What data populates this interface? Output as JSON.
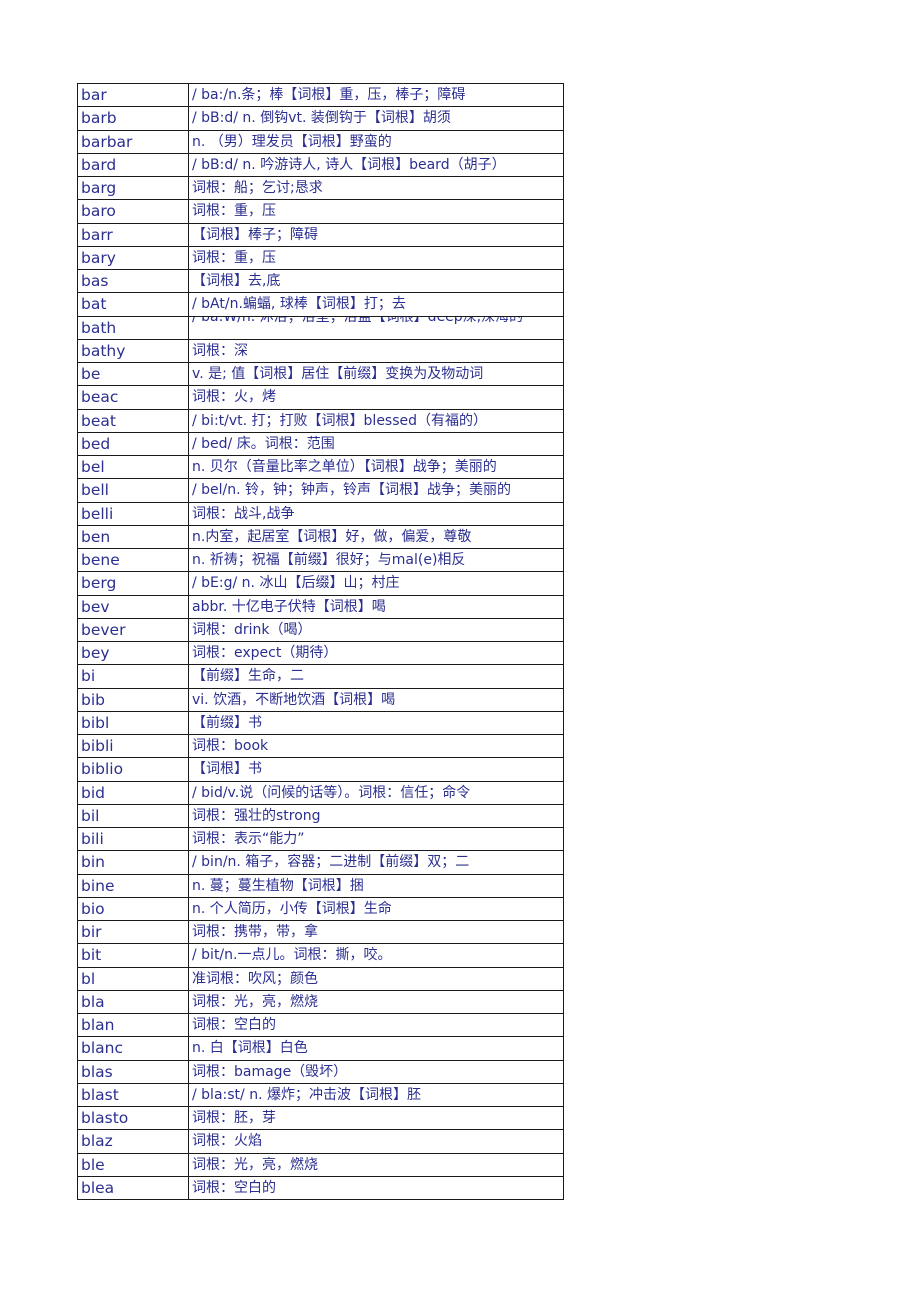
{
  "document": {
    "table": {
      "columns": [
        "term",
        "definition"
      ],
      "rows": [
        {
          "term": "bar",
          "definition": "/ ba:/n.条；棒【词根】重，压，棒子；障碍"
        },
        {
          "term": "barb",
          "definition": "/ bB:d/ n. 倒钩vt. 装倒钩于【词根】胡须"
        },
        {
          "term": "barbar",
          "definition": "n. （男）理发员【词根】野蛮的"
        },
        {
          "term": "bard",
          "definition": "/ bB:d/ n. 吟游诗人, 诗人【词根】beard（胡子）"
        },
        {
          "term": "barg",
          "definition": "词根：船；乞讨;恳求"
        },
        {
          "term": "baro",
          "definition": "词根：重，压"
        },
        {
          "term": "barr",
          "definition": "【词根】棒子；障碍"
        },
        {
          "term": "bary",
          "definition": "词根：重，压"
        },
        {
          "term": "bas",
          "definition": "【词根】去,底"
        },
        {
          "term": "bat",
          "definition": "/ bAt/n.蝙蝠, 球棒【词根】打；去"
        },
        {
          "term": "bath",
          "definition": "/ ba:W/n. 沐浴；浴室；浴盆【词根】deep深,深海的"
        },
        {
          "term": "bathy",
          "definition": "词根：深"
        },
        {
          "term": "be",
          "definition": "v. 是; 值【词根】居住【前缀】变换为及物动词"
        },
        {
          "term": "beac",
          "definition": "词根：火，烤"
        },
        {
          "term": "beat",
          "definition": "/ bi:t/vt. 打；打败【词根】blessed（有福的）"
        },
        {
          "term": "bed",
          "definition": "/ bed/  床。词根：范围"
        },
        {
          "term": "bel",
          "definition": "n. 贝尔（音量比率之单位）【词根】战争；美丽的"
        },
        {
          "term": "bell",
          "definition": "/ bel/n. 铃，钟；钟声，铃声【词根】战争；美丽的"
        },
        {
          "term": "belli",
          "definition": "词根：战斗,战争"
        },
        {
          "term": "ben",
          "definition": "n.内室，起居室【词根】好，做，偏爱，尊敬"
        },
        {
          "term": "bene",
          "definition": "n. 祈祷；祝福【前缀】很好；与mal(e)相反"
        },
        {
          "term": "berg",
          "definition": "/ bE:g/ n. 冰山【后缀】山；村庄"
        },
        {
          "term": "bev",
          "definition": "abbr. 十亿电子伏特【词根】喝"
        },
        {
          "term": "bever",
          "definition": "词根：drink（喝）"
        },
        {
          "term": "bey",
          "definition": "词根：expect（期待）"
        },
        {
          "term": "bi",
          "definition": "【前缀】生命，二"
        },
        {
          "term": "bib",
          "definition": "vi. 饮酒，不断地饮酒【词根】喝"
        },
        {
          "term": "bibl",
          "definition": "【前缀】书"
        },
        {
          "term": "bibli",
          "definition": "词根：book"
        },
        {
          "term": "biblio",
          "definition": "【词根】书"
        },
        {
          "term": "bid",
          "definition": "/ bid/v.说（问候的话等）。词根：信任；命令"
        },
        {
          "term": "bil",
          "definition": "词根：强壮的strong"
        },
        {
          "term": "bili",
          "definition": "词根：表示“能力”"
        },
        {
          "term": "bin",
          "definition": "/ bin/n. 箱子，容器；二进制【前缀】双；二"
        },
        {
          "term": "bine",
          "definition": "n. 蔓；蔓生植物【词根】捆"
        },
        {
          "term": "bio",
          "definition": "n. 个人简历，小传【词根】生命"
        },
        {
          "term": "bir",
          "definition": "词根：携带，带，拿"
        },
        {
          "term": "bit",
          "definition": "/ bit/n.一点儿。词根：撕，咬。"
        },
        {
          "term": "bl",
          "definition": "准词根：吹风；颜色"
        },
        {
          "term": "bla",
          "definition": "词根：光，亮，燃烧"
        },
        {
          "term": "blan",
          "definition": "词根：空白的"
        },
        {
          "term": "blanc",
          "definition": "n. 白【词根】白色"
        },
        {
          "term": "blas",
          "definition": "词根：bamage（毁坏）"
        },
        {
          "term": "blast",
          "definition": "/ bla:st/ n. 爆炸；冲击波【词根】胚"
        },
        {
          "term": "blasto",
          "definition": "词根：胚，芽"
        },
        {
          "term": "blaz",
          "definition": "词根：火焰"
        },
        {
          "term": "ble",
          "definition": "词根：光，亮，燃烧"
        },
        {
          "term": "blea",
          "definition": "词根：空白的"
        }
      ]
    }
  }
}
